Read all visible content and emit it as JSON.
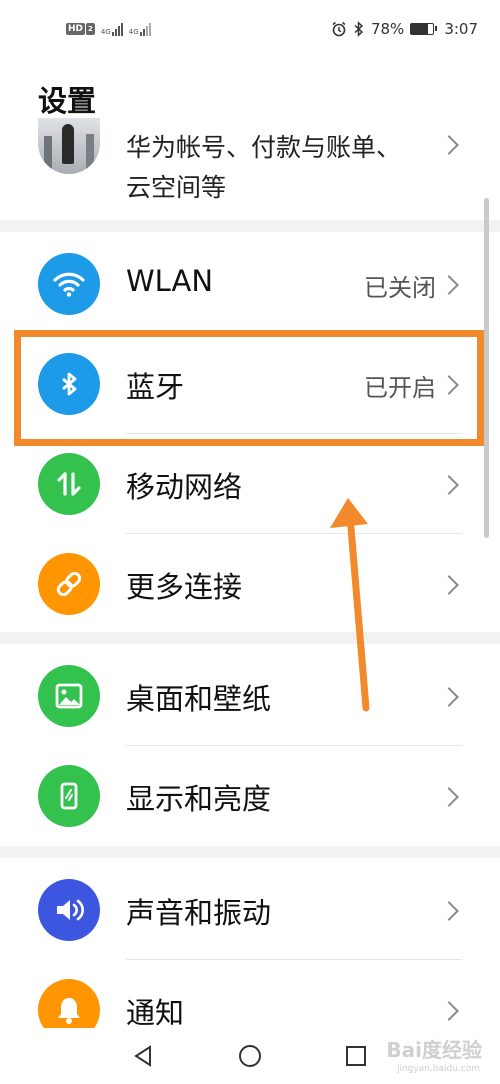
{
  "status_bar": {
    "hd_badge": "HD",
    "hd_sub": "2",
    "net1": "4G",
    "net2": "4G",
    "alarm_icon": "alarm-icon",
    "bluetooth_icon": "bluetooth-icon",
    "battery": "78%",
    "battery_level": 0.78,
    "time": "3:07"
  },
  "title": "设置",
  "account": {
    "text": "华为帐号、付款与账单、云空间等"
  },
  "rows": [
    {
      "label": "WLAN",
      "status": "已关闭",
      "icon": "wifi-icon",
      "color": "#1e9be8"
    },
    {
      "label": "蓝牙",
      "status": "已开启",
      "icon": "bluetooth-icon",
      "color": "#1e9be8"
    },
    {
      "label": "移动网络",
      "status": "",
      "icon": "mobile-data-icon",
      "color": "#33c24d"
    },
    {
      "label": "更多连接",
      "status": "",
      "icon": "link-icon",
      "color": "#ff9500"
    },
    {
      "label": "桌面和壁纸",
      "status": "",
      "icon": "wallpaper-icon",
      "color": "#33c24d"
    },
    {
      "label": "显示和亮度",
      "status": "",
      "icon": "display-icon",
      "color": "#33c24d"
    },
    {
      "label": "声音和振动",
      "status": "",
      "icon": "sound-icon",
      "color": "#3d56e0"
    },
    {
      "label": "通知",
      "status": "",
      "icon": "bell-icon",
      "color": "#ff9500"
    }
  ],
  "watermark": "Bai度经验",
  "watermark_sub": "jingyan.baidu.com",
  "accent_highlight": "#f28a2c"
}
